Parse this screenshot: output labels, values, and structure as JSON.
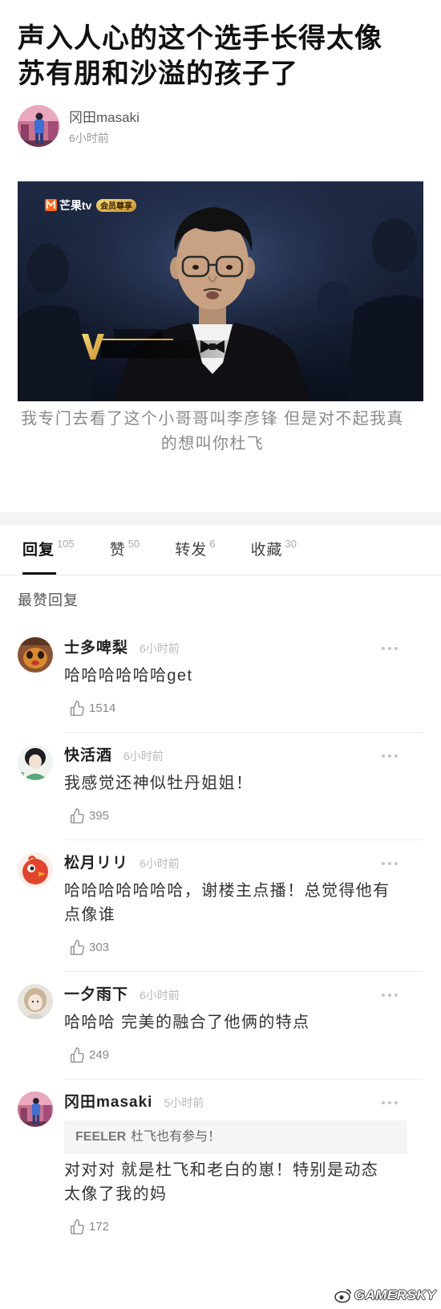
{
  "post": {
    "title": "声入人心的这个选手长得太像苏有朋和沙溢的孩子了",
    "author": {
      "name": "冈田masaki",
      "time": "6小时前"
    },
    "image": {
      "logo_brand": "芒果tv",
      "logo_badge": "会员尊享"
    },
    "caption": "我专门去看了这个小哥哥叫李彦锋 但是对不起我真的想叫你杜飞"
  },
  "tabs": [
    {
      "label": "回复",
      "count": "105",
      "active": true
    },
    {
      "label": "赞",
      "count": "50",
      "active": false
    },
    {
      "label": "转发",
      "count": "6",
      "active": false
    },
    {
      "label": "收藏",
      "count": "30",
      "active": false
    }
  ],
  "section_title": "最赞回复",
  "comments": [
    {
      "name": "士多啤梨",
      "time": "6小时前",
      "text": "哈哈哈哈哈哈get",
      "likes": "1514"
    },
    {
      "name": "快活酒",
      "time": "6小时前",
      "text": "我感觉还神似牡丹姐姐！",
      "likes": "395"
    },
    {
      "name": "松月リリ",
      "time": "6小时前",
      "text": "哈哈哈哈哈哈哈，谢楼主点播！总觉得他有点像谁",
      "likes": "303"
    },
    {
      "name": "一夕雨下",
      "time": "6小时前",
      "text": "哈哈哈 完美的融合了他俩的特点",
      "likes": "249"
    },
    {
      "name": "冈田masaki",
      "time": "5小时前",
      "quote": {
        "user": "FEELER",
        "text": "杜飞也有参与！"
      },
      "text": "对对对 就是杜飞和老白的崽！特别是动态 太像了我的妈",
      "likes": "172"
    }
  ],
  "watermark": "GAMERSKY",
  "icons": {
    "like": "thumbs-up-icon",
    "more": "more-horizontal-icon",
    "watermark_logo": "weibo-logo-icon"
  },
  "colors": {
    "title": "#111111",
    "muted": "#999999",
    "divider": "#ececec",
    "band": "#f4f4f4",
    "brand_orange": "#ff6a1a"
  }
}
